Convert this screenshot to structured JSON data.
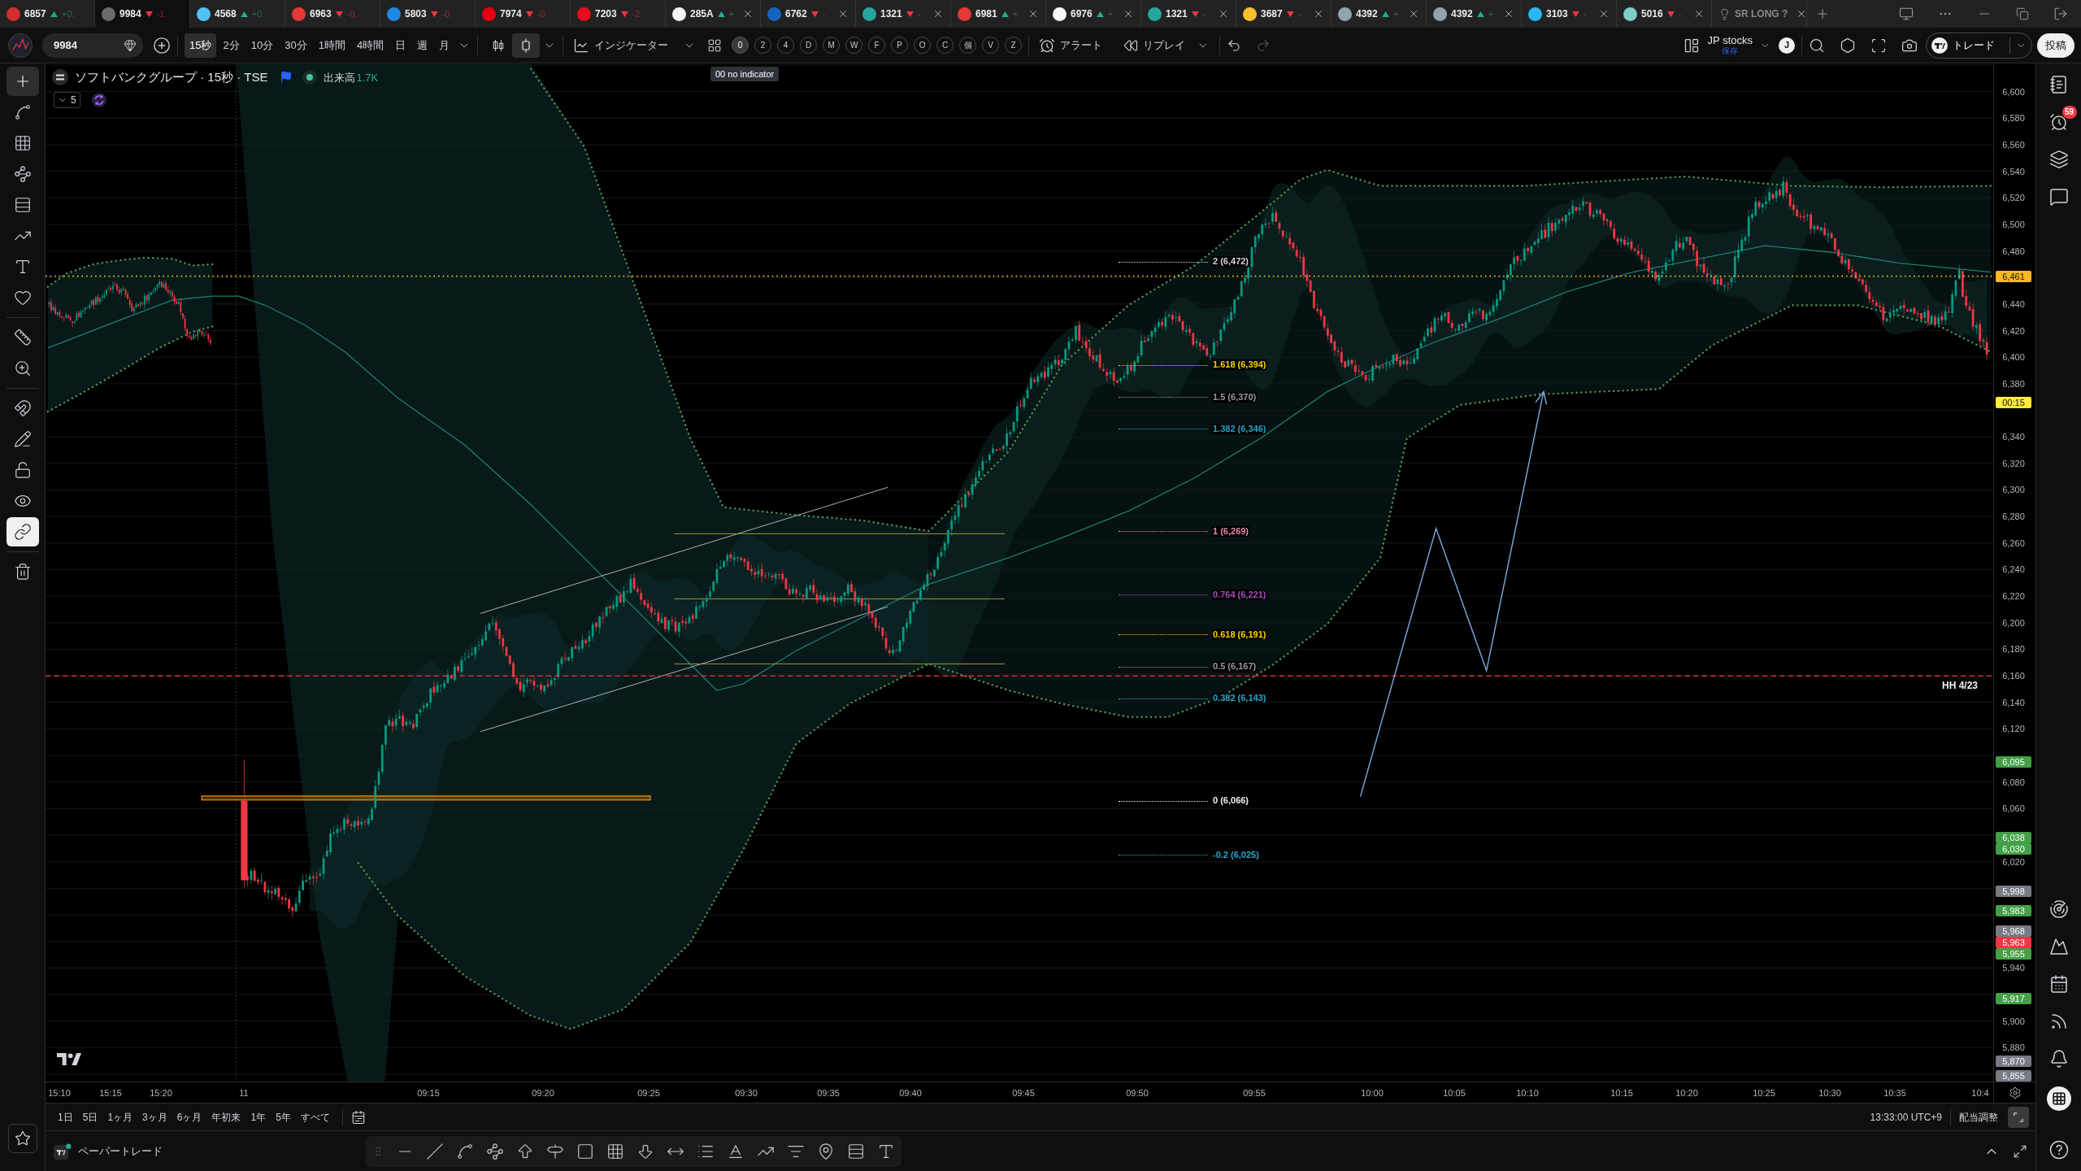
{
  "tab_bar": {
    "tabs": [
      {
        "kind": "symbol",
        "symbol": "6857",
        "rising": true,
        "change": "+0.",
        "color": "#d32f2f",
        "selected": false,
        "closable": false
      },
      {
        "kind": "symbol",
        "symbol": "9984",
        "rising": false,
        "change": "-1.",
        "color": "#6b6b6b",
        "selected": true,
        "closable": false
      },
      {
        "kind": "symbol",
        "symbol": "4568",
        "rising": true,
        "change": "+0.",
        "color": "#4fc3f7",
        "selected": false,
        "closable": false
      },
      {
        "kind": "symbol",
        "symbol": "6963",
        "rising": false,
        "change": "-0.",
        "color": "#e53935",
        "selected": false,
        "closable": false
      },
      {
        "kind": "symbol",
        "symbol": "5803",
        "rising": false,
        "change": "-0.",
        "color": "#1e88e5",
        "selected": false,
        "closable": false
      },
      {
        "kind": "symbol",
        "symbol": "7974",
        "rising": false,
        "change": "-0.",
        "color": "#e60012",
        "selected": false,
        "closable": false
      },
      {
        "kind": "symbol",
        "symbol": "7203",
        "rising": false,
        "change": "-2.",
        "color": "#eb0a1e",
        "selected": false,
        "closable": false
      },
      {
        "kind": "symbol",
        "symbol": "285A",
        "rising": true,
        "change": "+",
        "color": "#f5f5f5",
        "selected": false,
        "closable": true
      },
      {
        "kind": "symbol",
        "symbol": "6762",
        "rising": false,
        "change": "-",
        "color": "#1565c0",
        "selected": false,
        "closable": true
      },
      {
        "kind": "symbol",
        "symbol": "1321",
        "rising": false,
        "change": "-",
        "color": "#26a69a",
        "selected": false,
        "closable": true
      },
      {
        "kind": "symbol",
        "symbol": "6981",
        "rising": true,
        "change": "+",
        "color": "#e53935",
        "selected": false,
        "closable": true
      },
      {
        "kind": "symbol",
        "symbol": "6976",
        "rising": true,
        "change": "+",
        "color": "#fafafa",
        "selected": false,
        "closable": true
      },
      {
        "kind": "symbol",
        "symbol": "1321",
        "rising": false,
        "change": "-",
        "color": "#26a69a",
        "selected": false,
        "closable": true
      },
      {
        "kind": "symbol",
        "symbol": "3687",
        "rising": false,
        "change": "-",
        "color": "#fbc02d",
        "selected": false,
        "closable": true
      },
      {
        "kind": "symbol",
        "symbol": "4392",
        "rising": true,
        "change": "+",
        "color": "#90a4ae",
        "selected": false,
        "closable": true
      },
      {
        "kind": "symbol",
        "symbol": "4392",
        "rising": true,
        "change": "+",
        "color": "#90a4ae",
        "selected": false,
        "closable": true
      },
      {
        "kind": "symbol",
        "symbol": "3103",
        "rising": false,
        "change": "-",
        "color": "#29b6f6",
        "selected": false,
        "closable": true
      },
      {
        "kind": "symbol",
        "symbol": "5016",
        "rising": false,
        "change": "-",
        "color": "#80cbc4",
        "selected": false,
        "closable": true
      },
      {
        "kind": "layout",
        "symbol": "SR LONG ?",
        "selected": false,
        "closable": true
      }
    ]
  },
  "toolbar": {
    "symbol_field": {
      "value": "9984"
    },
    "intervals": [
      {
        "label": "15秒",
        "selected": true
      },
      {
        "label": "2分",
        "selected": false
      },
      {
        "label": "10分",
        "selected": false
      },
      {
        "label": "30分",
        "selected": false
      },
      {
        "label": "1時間",
        "selected": false
      },
      {
        "label": "4時間",
        "selected": false
      },
      {
        "label": "日",
        "selected": false
      },
      {
        "label": "週",
        "selected": false
      },
      {
        "label": "月",
        "selected": false
      }
    ],
    "chart_styles": [
      {
        "kind": "candles",
        "selected": false
      },
      {
        "kind": "hollow-candle",
        "selected": true
      }
    ],
    "indicators_label": "インジケーター",
    "quick_buttons": [
      {
        "label": "0",
        "selected": true
      },
      {
        "label": "2",
        "selected": false
      },
      {
        "label": "4",
        "selected": false
      },
      {
        "label": "D",
        "selected": false
      },
      {
        "label": "M",
        "selected": false
      },
      {
        "label": "W",
        "selected": false
      },
      {
        "label": "F",
        "selected": false
      },
      {
        "label": "P",
        "selected": false
      },
      {
        "label": "O",
        "selected": false
      },
      {
        "label": "C",
        "selected": false
      },
      {
        "label": "個",
        "selected": false
      },
      {
        "label": "V",
        "selected": false
      },
      {
        "label": "Z",
        "selected": false
      }
    ],
    "tooltip": "00 no indicator",
    "alert_label": "アラート",
    "replay_label": "リプレイ",
    "history": [
      {
        "kind": "undo",
        "disabled": false
      },
      {
        "kind": "redo",
        "disabled": true
      }
    ],
    "layout_name": "JP stocks",
    "save_status": "保存",
    "user_initial": "J",
    "trade_label": "トレード",
    "publish_label": "投稿"
  },
  "left_toolbar": {
    "groups": [
      [
        {
          "kind": "crosshair",
          "selected": true
        },
        {
          "kind": "trend-line",
          "selected": false
        },
        {
          "kind": "fib-grid",
          "selected": false
        },
        {
          "kind": "pattern",
          "selected": false
        },
        {
          "kind": "position",
          "selected": false
        },
        {
          "kind": "path",
          "selected": false
        },
        {
          "kind": "text",
          "selected": false
        },
        {
          "kind": "heart",
          "selected": false
        }
      ],
      [
        {
          "kind": "ruler",
          "selected": false
        },
        {
          "kind": "zoom",
          "selected": false
        }
      ],
      [
        {
          "kind": "magnet",
          "selected": false
        },
        {
          "kind": "drawing-lock",
          "selected": false
        },
        {
          "kind": "lock",
          "selected": false
        },
        {
          "kind": "eye",
          "selected": false
        },
        {
          "kind": "link",
          "selected": true
        }
      ],
      [
        {
          "kind": "trash",
          "selected": false
        }
      ]
    ]
  },
  "chart": {
    "legend": {
      "title": "ソフトバンクグループ · 15秒 · TSE",
      "volume_label": "出来高",
      "volume_value": "1.7K",
      "collapsed_count": "5"
    },
    "fib_levels": [
      {
        "label": "2 (6,472)",
        "color": "#d1d4dc"
      },
      {
        "label": "1.618 (6,394)",
        "color": "#f7d100"
      },
      {
        "label": "1.5 (6,370)",
        "color": "#9598a1"
      },
      {
        "label": "1.382 (6,346)",
        "color": "#22a7c9"
      },
      {
        "label": "1 (6,269)",
        "color": "#e38ba8"
      },
      {
        "label": "0.764 (6,221)",
        "color": "#a64dbb"
      },
      {
        "label": "0.618 (6,191)",
        "color": "#f7d100"
      },
      {
        "label": "0.5 (6,167)",
        "color": "#9598a1"
      },
      {
        "label": "0.382 (6,143)",
        "color": "#22a7c9"
      },
      {
        "label": "0 (6,066)",
        "color": "#f0f0f0"
      },
      {
        "label": "-0.2 (6,025)",
        "color": "#22a7c9"
      }
    ],
    "line_label": "HH 4/23",
    "time_axis": [
      "15:10",
      "15:15",
      "15:20",
      "11",
      "09:15",
      "09:20",
      "09:25",
      "09:30",
      "09:35",
      "09:40",
      "09:45",
      "09:50",
      "09:55",
      "10:00",
      "10:05",
      "10:10",
      "10:15",
      "10:20",
      "10:25",
      "10:30",
      "10:35",
      "10:4"
    ]
  },
  "price_axis": {
    "ticks": [
      "6,600",
      "6,580",
      "6,560",
      "6,540",
      "6,520",
      "6,500",
      "6,480",
      "6,440",
      "6,420",
      "6,400",
      "6,380",
      "6,340",
      "6,320",
      "6,300",
      "6,280",
      "6,260",
      "6,240",
      "6,220",
      "6,200",
      "6,180",
      "6,160",
      "6,140",
      "6,120",
      "6,080",
      "6,060",
      "6,020",
      "5,940",
      "5,900",
      "5,880"
    ],
    "tags": [
      {
        "text": "6,461",
        "kind": "line",
        "color": "#f9b826"
      },
      {
        "text": "00:15",
        "kind": "countdown",
        "color": "#ffeb3b"
      },
      {
        "text": "6,095",
        "kind": "price",
        "color": "#43a047"
      },
      {
        "text": "6,038",
        "kind": "price",
        "color": "#43a047"
      },
      {
        "text": "6,030",
        "kind": "price",
        "color": "#43a047"
      },
      {
        "text": "5,998",
        "kind": "price",
        "color": "#787b86"
      },
      {
        "text": "5,983",
        "kind": "price",
        "color": "#43a047"
      },
      {
        "text": "5,968",
        "kind": "price",
        "color": "#787b86"
      },
      {
        "text": "5,963",
        "kind": "price",
        "color": "#f23645"
      },
      {
        "text": "5,955",
        "kind": "price",
        "color": "#43a047"
      },
      {
        "text": "5,917",
        "kind": "price",
        "color": "#43a047"
      },
      {
        "text": "5,870",
        "kind": "price",
        "color": "#787b86"
      },
      {
        "text": "5,855",
        "kind": "price",
        "color": "#787b86"
      }
    ]
  },
  "range_bar": {
    "ranges": [
      "1日",
      "5日",
      "1ヶ月",
      "3ヶ月",
      "6ヶ月",
      "年初来",
      "1年",
      "5年",
      "すべて"
    ],
    "clock": "13:33:00 UTC+9",
    "adjust_label": "配当調整",
    "scale_selected": true
  },
  "bottom_panel": {
    "paper_trading_label": "ペーパートレード"
  },
  "right_sidebar": {
    "alert_badge": "59"
  }
}
